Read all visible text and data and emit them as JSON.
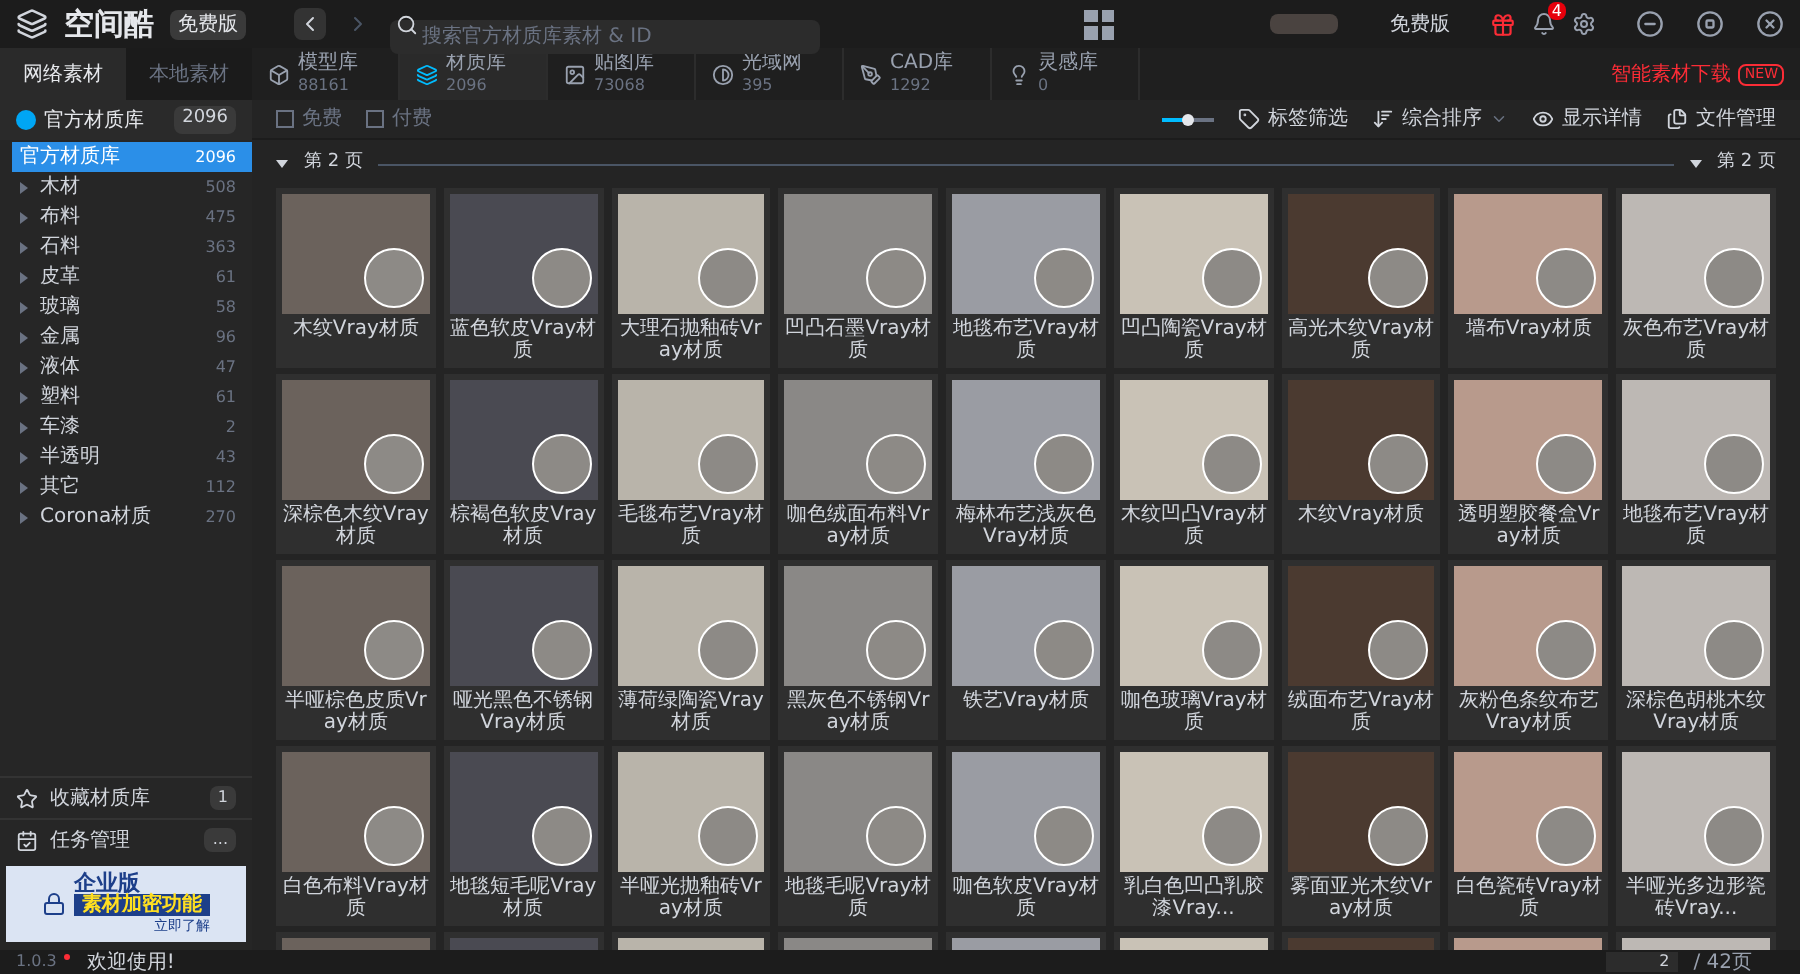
{
  "app": {
    "logo": "空间酷",
    "edition_badge": "免费版"
  },
  "search": {
    "placeholder": "搜索官方材质库素材 & ID"
  },
  "top_right": {
    "edition": "免费版",
    "notification_count": "4"
  },
  "source_tabs": [
    {
      "label": "网络素材",
      "selected": true
    },
    {
      "label": "本地素材",
      "selected": false
    }
  ],
  "library_tabs": [
    {
      "kind": "model",
      "label": "模型库",
      "count": "88161",
      "selected": false
    },
    {
      "kind": "material",
      "label": "材质库",
      "count": "2096",
      "selected": true
    },
    {
      "kind": "texture",
      "label": "贴图库",
      "count": "73068",
      "selected": false
    },
    {
      "kind": "ies",
      "label": "光域网",
      "count": "395",
      "selected": false
    },
    {
      "kind": "cad",
      "label": "CAD库",
      "count": "1292",
      "selected": false
    },
    {
      "kind": "idea",
      "label": "灵感库",
      "count": "0",
      "selected": false
    }
  ],
  "smart_download": {
    "label": "智能素材下载",
    "badge": "NEW"
  },
  "sidebar": {
    "header": {
      "label": "官方材质库",
      "count": "2096"
    },
    "items": [
      {
        "label": "官方材质库",
        "count": "2096",
        "selected": true,
        "expandable": false
      },
      {
        "label": "木材",
        "count": "508",
        "selected": false,
        "expandable": true
      },
      {
        "label": "布料",
        "count": "475",
        "selected": false,
        "expandable": true
      },
      {
        "label": "石料",
        "count": "363",
        "selected": false,
        "expandable": true
      },
      {
        "label": "皮革",
        "count": "61",
        "selected": false,
        "expandable": true
      },
      {
        "label": "玻璃",
        "count": "58",
        "selected": false,
        "expandable": true
      },
      {
        "label": "金属",
        "count": "96",
        "selected": false,
        "expandable": true
      },
      {
        "label": "液体",
        "count": "47",
        "selected": false,
        "expandable": true
      },
      {
        "label": "塑料",
        "count": "61",
        "selected": false,
        "expandable": true
      },
      {
        "label": "车漆",
        "count": "2",
        "selected": false,
        "expandable": true
      },
      {
        "label": "半透明",
        "count": "43",
        "selected": false,
        "expandable": true
      },
      {
        "label": "其它",
        "count": "112",
        "selected": false,
        "expandable": true
      },
      {
        "label": "Corona材质",
        "count": "270",
        "selected": false,
        "expandable": true
      }
    ],
    "bottom": [
      {
        "kind": "favorites",
        "label": "收藏材质库",
        "count": "1"
      },
      {
        "kind": "tasks",
        "label": "任务管理",
        "count": "..."
      }
    ],
    "banner": {
      "title": "企业版",
      "subtitle": "素材加密功能",
      "link": "立即了解"
    }
  },
  "filters": [
    {
      "label": "免费",
      "checked": false
    },
    {
      "label": "付费",
      "checked": false
    }
  ],
  "zoom_slider": {
    "level": 0.5
  },
  "toolbar": [
    {
      "kind": "tag",
      "label": "标签筛选"
    },
    {
      "kind": "sort",
      "label": "综合排序"
    },
    {
      "kind": "eye",
      "label": "显示详情"
    },
    {
      "kind": "files",
      "label": "文件管理"
    }
  ],
  "page_header": {
    "left": "第 2 页",
    "right": "第 2 页"
  },
  "cards": [
    {
      "kind": "full",
      "caption": "木纹Vray材质"
    },
    {
      "kind": "full",
      "caption": "蓝色软皮Vray材质"
    },
    {
      "kind": "full",
      "caption": "大理石抛釉砖Vray材质"
    },
    {
      "kind": "full",
      "caption": "凹凸石墨Vray材质"
    },
    {
      "kind": "full",
      "caption": "地毯布艺Vray材质"
    },
    {
      "kind": "full",
      "caption": "凹凸陶瓷Vray材质"
    },
    {
      "kind": "full",
      "caption": "高光木纹Vray材质"
    },
    {
      "kind": "full",
      "caption": "墙布Vray材质"
    },
    {
      "kind": "full",
      "caption": "灰色布艺Vray材质"
    },
    {
      "kind": "full",
      "caption": "深棕色木纹Vray材质"
    },
    {
      "kind": "full",
      "caption": "棕褐色软皮Vray材质"
    },
    {
      "kind": "full",
      "caption": "毛毯布艺Vray材质"
    },
    {
      "kind": "full",
      "caption": "咖色绒面布料Vray材质"
    },
    {
      "kind": "full",
      "caption": "梅林布艺浅灰色Vray材质"
    },
    {
      "kind": "full",
      "caption": "木纹凹凸Vray材质"
    },
    {
      "kind": "full",
      "caption": "木纹Vray材质"
    },
    {
      "kind": "full",
      "caption": "透明塑胶餐盒Vray材质"
    },
    {
      "kind": "full",
      "caption": "地毯布艺Vray材质"
    },
    {
      "kind": "full",
      "caption": "半哑棕色皮质Vray材质"
    },
    {
      "kind": "full",
      "caption": "哑光黑色不锈钢Vray材质"
    },
    {
      "kind": "full",
      "caption": "薄荷绿陶瓷Vray材质"
    },
    {
      "kind": "full",
      "caption": "黑灰色不锈钢Vray材质"
    },
    {
      "kind": "full",
      "caption": "铁艺Vray材质"
    },
    {
      "kind": "full",
      "caption": "咖色玻璃Vray材质"
    },
    {
      "kind": "full",
      "caption": "绒面布艺Vray材质"
    },
    {
      "kind": "full",
      "caption": "灰粉色条纹布艺Vray材质"
    },
    {
      "kind": "full",
      "caption": "深棕色胡桃木纹Vray材质"
    },
    {
      "kind": "full",
      "caption": "白色布料Vray材质"
    },
    {
      "kind": "full",
      "caption": "地毯短毛呢Vray材质"
    },
    {
      "kind": "full",
      "caption": "半哑光抛釉砖Vray材质"
    },
    {
      "kind": "full",
      "caption": "地毯毛呢Vray材质"
    },
    {
      "kind": "full",
      "caption": "咖色软皮Vray材质"
    },
    {
      "kind": "full",
      "caption": "乳白色凹凸乳胶漆Vray..."
    },
    {
      "kind": "full",
      "caption": "雾面亚光木纹Vray材质"
    },
    {
      "kind": "full",
      "caption": "白色瓷砖Vray材质"
    },
    {
      "kind": "full",
      "caption": "半哑光多边形瓷砖Vray..."
    },
    {
      "kind": "cut"
    },
    {
      "kind": "cut"
    },
    {
      "kind": "cut"
    },
    {
      "kind": "cut"
    },
    {
      "kind": "cut"
    },
    {
      "kind": "cut"
    },
    {
      "kind": "cut"
    },
    {
      "kind": "cut"
    },
    {
      "kind": "cut"
    }
  ],
  "status_bar": {
    "version": "1.0.3",
    "message": "欢迎使用!",
    "page_input": "2",
    "page_total": "/ 42页"
  }
}
